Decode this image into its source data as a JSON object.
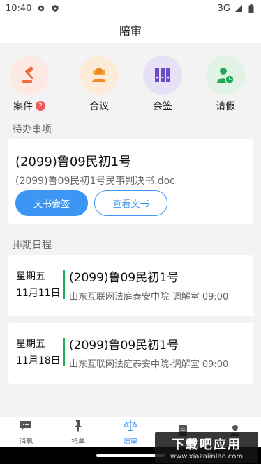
{
  "status_bar": {
    "time": "10:40",
    "network": "3G"
  },
  "header": {
    "title": "陪审"
  },
  "quick_actions": [
    {
      "label": "案件",
      "icon": "gavel-icon",
      "bg": "#fde9e4",
      "badge": "2"
    },
    {
      "label": "合议",
      "icon": "group-icon",
      "bg": "#fdebd9"
    },
    {
      "label": "会签",
      "icon": "binders-icon",
      "bg": "#e6e1f7"
    },
    {
      "label": "请假",
      "icon": "person-clock-icon",
      "bg": "#e2f3e6"
    }
  ],
  "todo": {
    "section_title": "待办事项",
    "case_title": "(2099)鲁09民初1号",
    "document": "(2099)鲁09民初1号民事判决书.doc",
    "primary_button": "文书会签",
    "secondary_button": "查看文书"
  },
  "schedule": {
    "section_title": "排期日程",
    "items": [
      {
        "weekday": "星期五",
        "date": "11月11日",
        "case_title": "(2099)鲁09民初1号",
        "location": "山东互联网法庭泰安中院-调解室 09:00"
      },
      {
        "weekday": "星期五",
        "date": "11月18日",
        "case_title": "(2099)鲁09民初1号",
        "location": "山东互联网法庭泰安中院-调解室 09:00"
      }
    ]
  },
  "bottom_nav": [
    {
      "label": "消息",
      "icon": "chat-icon"
    },
    {
      "label": "抢单",
      "icon": "pin-icon"
    },
    {
      "label": "陪审",
      "icon": "scales-icon",
      "active": true
    },
    {
      "label": "",
      "icon": "document-icon"
    },
    {
      "label": "",
      "icon": "person-icon"
    }
  ],
  "colors": {
    "accent": "#3d95f4",
    "green": "#18b050",
    "badge": "#ee5a5a"
  },
  "watermark": {
    "main": "下载吧应用",
    "sub": "www.xiazaiinlao.com"
  }
}
